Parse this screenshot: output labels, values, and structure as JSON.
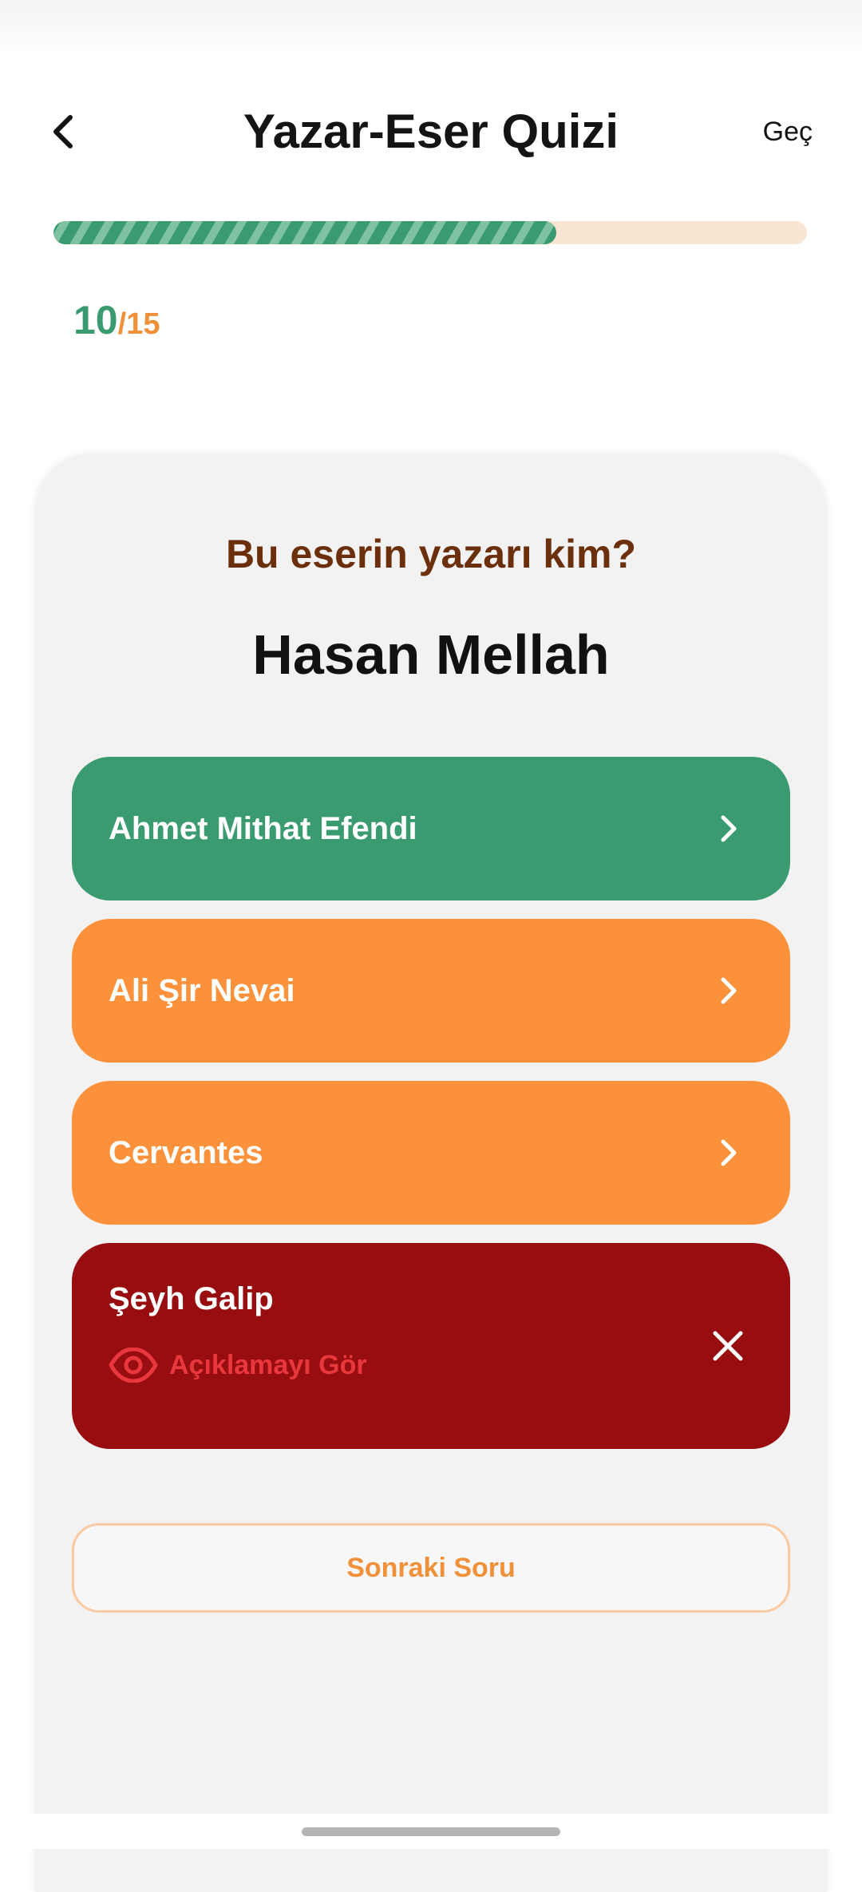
{
  "header": {
    "title": "Yazar-Eser Quizi",
    "skip_label": "Geç"
  },
  "progress": {
    "current": "10",
    "separator": "/",
    "total": "15",
    "fill_fraction": 0.667,
    "colors": {
      "fill": "#3a9b70",
      "stripe": "#7fc2a2",
      "track": "#f9e6d2"
    }
  },
  "question": {
    "prompt": "Bu eserin yazarı kim?",
    "work": "Hasan Mellah"
  },
  "options": [
    {
      "label": "Ahmet Mithat Efendi",
      "state": "correct",
      "icon": "chevron-right-icon"
    },
    {
      "label": "Ali Şir Nevai",
      "state": "neutral",
      "icon": "chevron-right-icon"
    },
    {
      "label": "Cervantes",
      "state": "neutral",
      "icon": "chevron-right-icon"
    },
    {
      "label": "Şeyh Galip",
      "state": "wrong",
      "icon": "close-icon",
      "explanation_label": "Açıklamayı Gör",
      "explanation_icon": "eye-icon"
    }
  ],
  "next_button": {
    "label": "Sonraki Soru"
  },
  "colors": {
    "correct": "#3a9b70",
    "neutral": "#fb913a",
    "wrong": "#980d0f",
    "accent_orange": "#f0913a",
    "question_text": "#6b2f0c"
  }
}
